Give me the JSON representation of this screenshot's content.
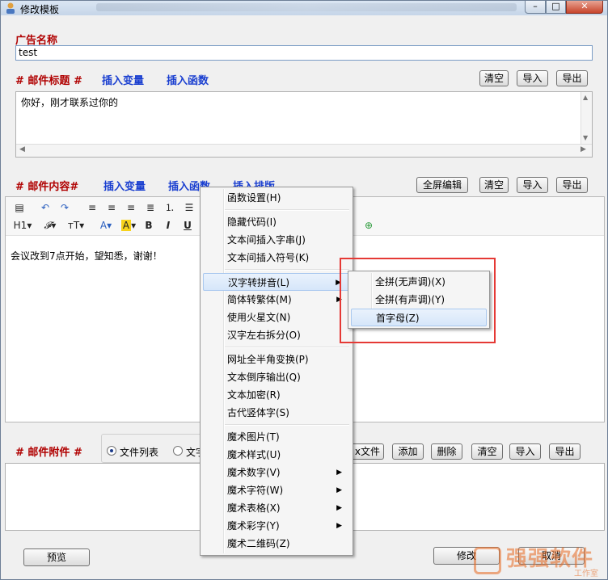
{
  "window": {
    "title": "修改模板"
  },
  "ad": {
    "label": "广告名称",
    "value": "test"
  },
  "subject": {
    "label": "# 邮件标题 #",
    "insert_var": "插入变量",
    "insert_func": "插入函数",
    "clear": "清空",
    "import": "导入",
    "export": "导出",
    "text": "你好，刚才联系过你的"
  },
  "content": {
    "label": "# 邮件内容#",
    "insert_var": "插入变量",
    "insert_func": "插入函数",
    "insert_layout": "插入排版",
    "fullscreen": "全屏编辑",
    "clear": "清空",
    "import": "导入",
    "export": "导出",
    "text": "会议改到7点开始，望知悉，谢谢！"
  },
  "attach": {
    "label": "# 邮件附件 #",
    "radio_list": "文件列表",
    "radio_text": "文字",
    "add_file": "x文件",
    "add": "添加",
    "delete": "删除",
    "clear": "清空",
    "import": "导入",
    "export": "导出"
  },
  "footer": {
    "preview": "预览",
    "modify": "修改",
    "cancel": "取消"
  },
  "context_menu": {
    "items": [
      {
        "label": "函数设置(H)"
      },
      {
        "label": "隐藏代码(I)"
      },
      {
        "label": "文本间插入字串(J)"
      },
      {
        "label": "文本间插入符号(K)"
      },
      {
        "label": "汉字转拼音(L)"
      },
      {
        "label": "简体转繁体(M)"
      },
      {
        "label": "使用火星文(N)"
      },
      {
        "label": "汉字左右拆分(O)"
      },
      {
        "label": "网址全半角变换(P)"
      },
      {
        "label": "文本倒序输出(Q)"
      },
      {
        "label": "文本加密(R)"
      },
      {
        "label": "古代竖体字(S)"
      },
      {
        "label": "魔术图片(T)"
      },
      {
        "label": "魔术样式(U)"
      },
      {
        "label": "魔术数字(V)"
      },
      {
        "label": "魔术字符(W)"
      },
      {
        "label": "魔术表格(X)"
      },
      {
        "label": "魔术彩字(Y)"
      },
      {
        "label": "魔术二维码(Z)"
      }
    ]
  },
  "submenu": {
    "items": [
      {
        "label": "全拼(无声调)(X)"
      },
      {
        "label": "全拼(有声调)(Y)"
      },
      {
        "label": "首字母(Z)"
      }
    ]
  },
  "watermark": {
    "text": "强强软件",
    "sub": "工作室"
  },
  "colors": {
    "highlight_box": "#e53935",
    "red_label": "#b00000",
    "blue_label": "#1a3fd0"
  }
}
